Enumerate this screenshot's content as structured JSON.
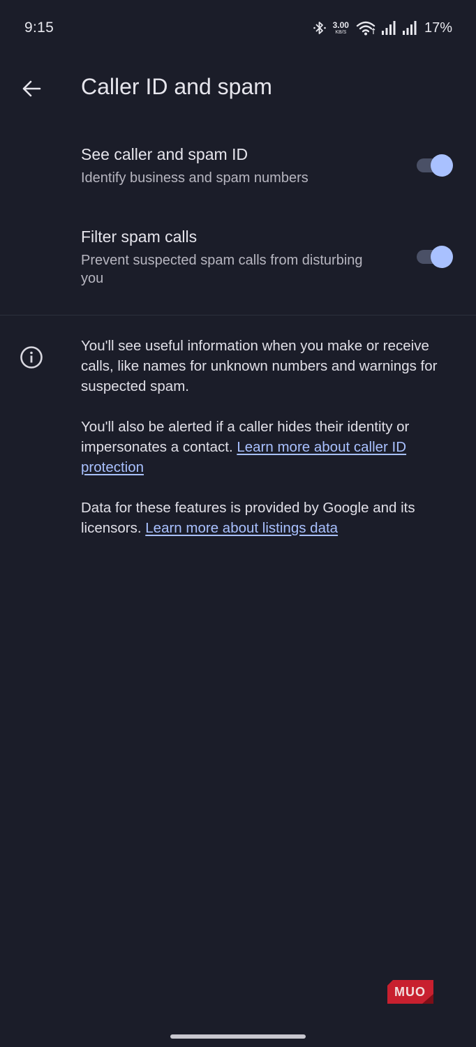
{
  "status_bar": {
    "time": "9:15",
    "net_speed_value": "3.00",
    "net_speed_unit": "KB/S",
    "battery": "17%"
  },
  "header": {
    "title": "Caller ID and spam",
    "back_icon": "arrow-back-icon"
  },
  "settings": [
    {
      "title": "See caller and spam ID",
      "subtitle": "Identify business and spam numbers",
      "enabled": true
    },
    {
      "title": "Filter spam calls",
      "subtitle": "Prevent suspected spam calls from disturbing you",
      "enabled": true
    }
  ],
  "info": {
    "icon": "info-icon",
    "paragraph1": "You'll see useful information when you make or receive calls, like names for unknown numbers and warnings for suspected spam.",
    "paragraph2_text": "You'll also be alerted if a caller hides their identity or impersonates a contact. ",
    "paragraph2_link": "Learn more about caller ID protection",
    "paragraph3_text": "Data for these features is provided by Google and its licensors. ",
    "paragraph3_link": "Learn more about listings data"
  },
  "watermark": {
    "text": "MUO"
  },
  "colors": {
    "background": "#1b1d29",
    "accent": "#a9c1ff",
    "toggle_track": "#4a5066",
    "watermark_red": "#c8202f"
  }
}
